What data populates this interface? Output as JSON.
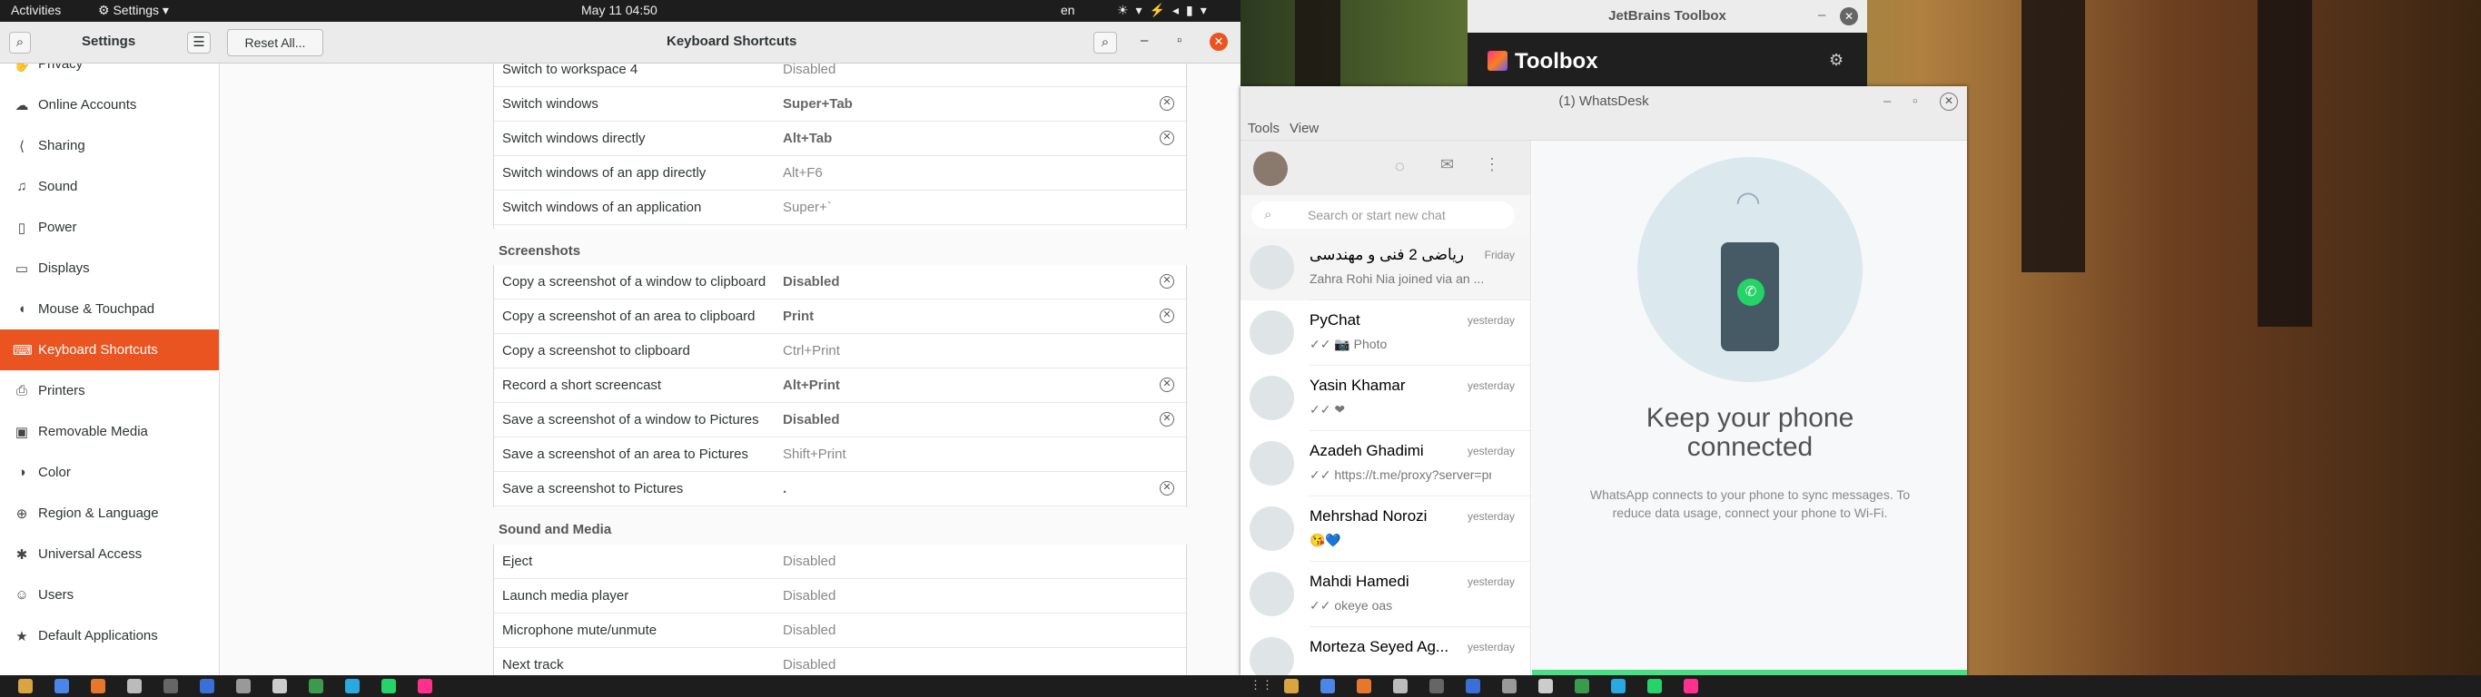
{
  "topbar": {
    "activities": "Activities",
    "app": "Settings",
    "clock": "May 11  04:50",
    "lang": "en"
  },
  "settings": {
    "title": "Settings",
    "reset": "Reset All...",
    "page_title": "Keyboard Shortcuts",
    "sidebar": [
      {
        "label": "Privacy",
        "icon": "privacy-icon",
        "glyph": "✋"
      },
      {
        "label": "Online Accounts",
        "icon": "cloud-icon",
        "glyph": "☁"
      },
      {
        "label": "Sharing",
        "icon": "share-icon",
        "glyph": "⟨"
      },
      {
        "label": "Sound",
        "icon": "note-icon",
        "glyph": "♫"
      },
      {
        "label": "Power",
        "icon": "battery-icon",
        "glyph": "▯"
      },
      {
        "label": "Displays",
        "icon": "display-icon",
        "glyph": "▭"
      },
      {
        "label": "Mouse & Touchpad",
        "icon": "mouse-icon",
        "glyph": "◖"
      },
      {
        "label": "Keyboard Shortcuts",
        "icon": "keyboard-icon",
        "glyph": "⌨"
      },
      {
        "label": "Printers",
        "icon": "printer-icon",
        "glyph": "⎙"
      },
      {
        "label": "Removable Media",
        "icon": "media-icon",
        "glyph": "▣"
      },
      {
        "label": "Color",
        "icon": "color-icon",
        "glyph": "◑"
      },
      {
        "label": "Region & Language",
        "icon": "globe-icon",
        "glyph": "⊕"
      },
      {
        "label": "Universal Access",
        "icon": "access-icon",
        "glyph": "✱"
      },
      {
        "label": "Users",
        "icon": "user-icon",
        "glyph": "☺"
      },
      {
        "label": "Default Applications",
        "icon": "star-icon",
        "glyph": "★"
      }
    ],
    "group1": [
      {
        "name": "Switch to workspace 4",
        "key": "Disabled",
        "bold": false,
        "x": false
      },
      {
        "name": "Switch windows",
        "key": "Super+Tab",
        "bold": true,
        "x": true
      },
      {
        "name": "Switch windows directly",
        "key": "Alt+Tab",
        "bold": true,
        "x": true
      },
      {
        "name": "Switch windows of an app directly",
        "key": "Alt+F6",
        "bold": false,
        "x": false
      },
      {
        "name": "Switch windows of an application",
        "key": "Super+`",
        "bold": false,
        "x": false
      }
    ],
    "section_screenshots": "Screenshots",
    "group2": [
      {
        "name": "Copy a screenshot of a window to clipboard",
        "key": "Disabled",
        "bold": true,
        "x": true
      },
      {
        "name": "Copy a screenshot of an area to clipboard",
        "key": "Print",
        "bold": true,
        "x": true
      },
      {
        "name": "Copy a screenshot to clipboard",
        "key": "Ctrl+Print",
        "bold": false,
        "x": false
      },
      {
        "name": "Record a short screencast",
        "key": "Alt+Print",
        "bold": true,
        "x": true
      },
      {
        "name": "Save a screenshot of a window to Pictures",
        "key": "Disabled",
        "bold": true,
        "x": true
      },
      {
        "name": "Save a screenshot of an area to Pictures",
        "key": "Shift+Print",
        "bold": false,
        "x": false
      },
      {
        "name": "Save a screenshot to Pictures",
        "key": ".",
        "bold": true,
        "x": true
      }
    ],
    "section_media": "Sound and Media",
    "group3": [
      {
        "name": "Eject",
        "key": "Disabled",
        "bold": false,
        "x": false
      },
      {
        "name": "Launch media player",
        "key": "Disabled",
        "bold": false,
        "x": false
      },
      {
        "name": "Microphone mute/unmute",
        "key": "Disabled",
        "bold": false,
        "x": false
      },
      {
        "name": "Next track",
        "key": "Disabled",
        "bold": false,
        "x": false
      }
    ]
  },
  "toolbox": {
    "title": "JetBrains Toolbox",
    "brand": "Toolbox"
  },
  "whatsdesk": {
    "title": "(1) WhatsDesk",
    "menu_tools": "Tools",
    "menu_view": "View",
    "search_placeholder": "Search or start new chat",
    "chats": [
      {
        "name": "ریاضی 2 فنی و مهندسی",
        "time": "Friday",
        "msg": "Zahra Rohi Nia joined via an ..."
      },
      {
        "name": "PyChat",
        "time": "yesterday",
        "msg": "✓✓ 📷 Photo"
      },
      {
        "name": "Yasin Khamar",
        "time": "yesterday",
        "msg": "✓✓ ❤"
      },
      {
        "name": "Azadeh Ghadimi",
        "time": "yesterday",
        "msg": "✓✓ https://t.me/proxy?server=pr..."
      },
      {
        "name": "Mehrshad Norozi",
        "time": "yesterday",
        "msg": "😘💙"
      },
      {
        "name": "Mahdi Hamedi",
        "time": "yesterday",
        "msg": "✓✓ okeye oas"
      },
      {
        "name": "Morteza Seyed Ag...",
        "time": "yesterday",
        "msg": ""
      }
    ],
    "empty_title": "Keep your phone connected",
    "empty_text": "WhatsApp connects to your phone to sync messages. To reduce data usage, connect your phone to Wi-Fi."
  }
}
